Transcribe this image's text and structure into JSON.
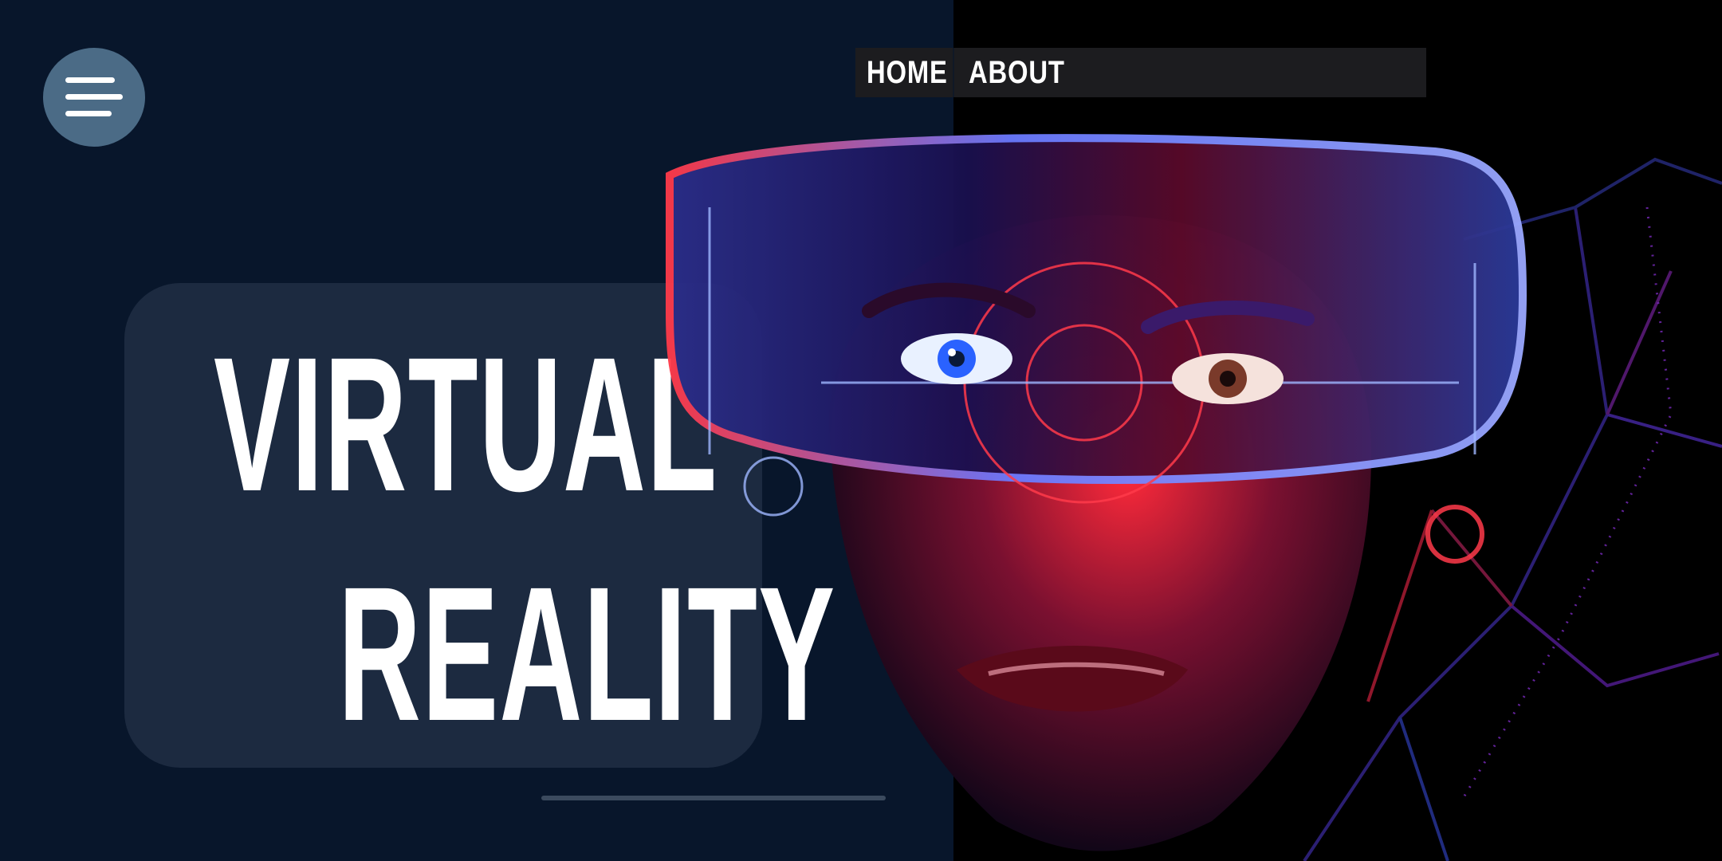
{
  "nav": {
    "home_label": "HOME",
    "about_label": "ABOUT"
  },
  "hero": {
    "title_line1": "VIRTUAL",
    "title_line2": "REALITY"
  },
  "icons": {
    "menu": "hamburger-menu-icon"
  },
  "colors": {
    "background_left": "#08162b",
    "background_right": "#000000",
    "card": "#1c2a40",
    "menu_button": "#4b6b86",
    "accent_red": "#ff2a3a",
    "accent_blue": "#3b5bff"
  }
}
